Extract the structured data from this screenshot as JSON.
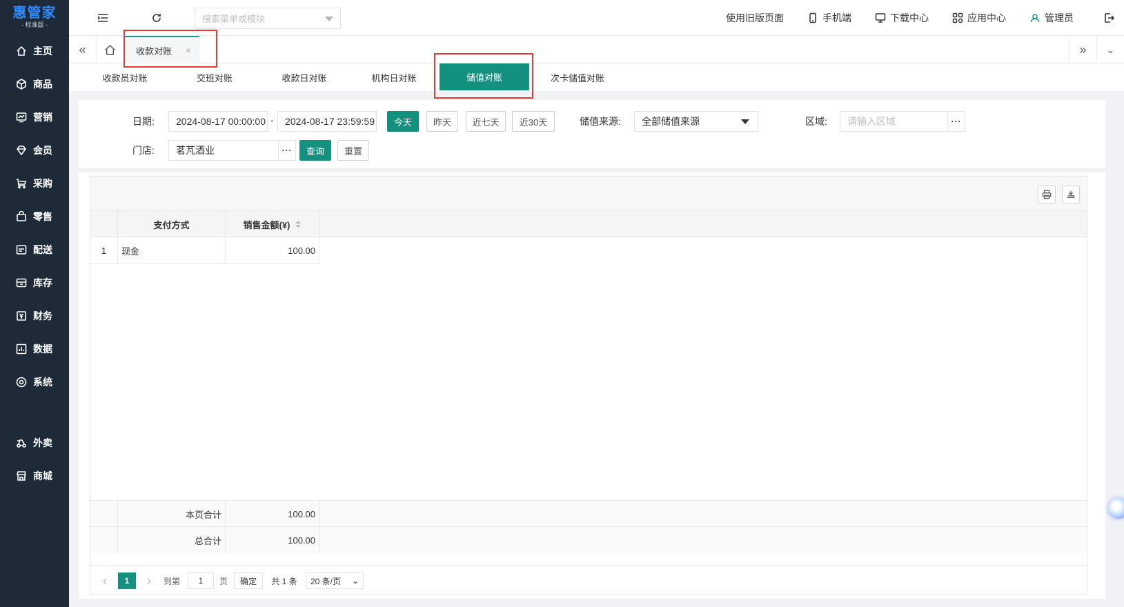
{
  "logo": {
    "name": "惠管家",
    "edition": "- 标准版 -"
  },
  "sidebar": {
    "items": [
      {
        "label": "主页",
        "icon": "home-icon"
      },
      {
        "label": "商品",
        "icon": "cube-icon"
      },
      {
        "label": "营销",
        "icon": "chart-icon"
      },
      {
        "label": "会员",
        "icon": "diamond-icon"
      },
      {
        "label": "采购",
        "icon": "cart-icon"
      },
      {
        "label": "零售",
        "icon": "bag-icon"
      },
      {
        "label": "配送",
        "icon": "truck-icon"
      },
      {
        "label": "库存",
        "icon": "box-icon"
      },
      {
        "label": "财务",
        "icon": "money-icon"
      },
      {
        "label": "数据",
        "icon": "bar-chart-icon"
      },
      {
        "label": "系统",
        "icon": "settings-icon"
      }
    ],
    "extra": [
      {
        "label": "外卖",
        "icon": "delivery-icon"
      },
      {
        "label": "商城",
        "icon": "store-icon"
      }
    ]
  },
  "topbar": {
    "search_placeholder": "搜索菜单或模块",
    "old_version": "使用旧版页面",
    "mobile": "手机端",
    "download": "下载中心",
    "apps": "应用中心",
    "user": "管理员"
  },
  "pagetabs": {
    "current": "收款对账",
    "close": "×"
  },
  "subtabs": [
    "收款员对账",
    "交班对账",
    "收款日对账",
    "机构日对账",
    "储值对账",
    "次卡储值对账"
  ],
  "filter": {
    "date_label": "日期:",
    "date_start": "2024-08-17 00:00:00",
    "date_sep": "-",
    "date_end": "2024-08-17 23:59:59",
    "today": "今天",
    "yesterday": "昨天",
    "last7": "近七天",
    "last30": "近30天",
    "source_label": "储值来源:",
    "source_value": "全部储值来源",
    "region_label": "区域:",
    "region_placeholder": "请输入区域",
    "store_label": "门店:",
    "store_value": "茗芃酒业",
    "query": "查询",
    "reset": "重置",
    "more": "···"
  },
  "table": {
    "headers": {
      "pay_method": "支付方式",
      "amount": "销售金额(¥)"
    },
    "rows": [
      {
        "index": "1",
        "pay_method": "现金",
        "amount": "100.00"
      }
    ],
    "page_total_label": "本页合计",
    "page_total": "100.00",
    "grand_total_label": "总合计",
    "grand_total": "100.00"
  },
  "pager": {
    "prev": "‹",
    "current": "1",
    "next": "›",
    "goto": "到第",
    "goto_value": "1",
    "page_unit": "页",
    "confirm": "确定",
    "total": "共 1 条",
    "page_size": "20 条/页"
  },
  "colors": {
    "accent": "#14907f",
    "sidebar": "#1f2a38",
    "highlight": "#e53935"
  }
}
